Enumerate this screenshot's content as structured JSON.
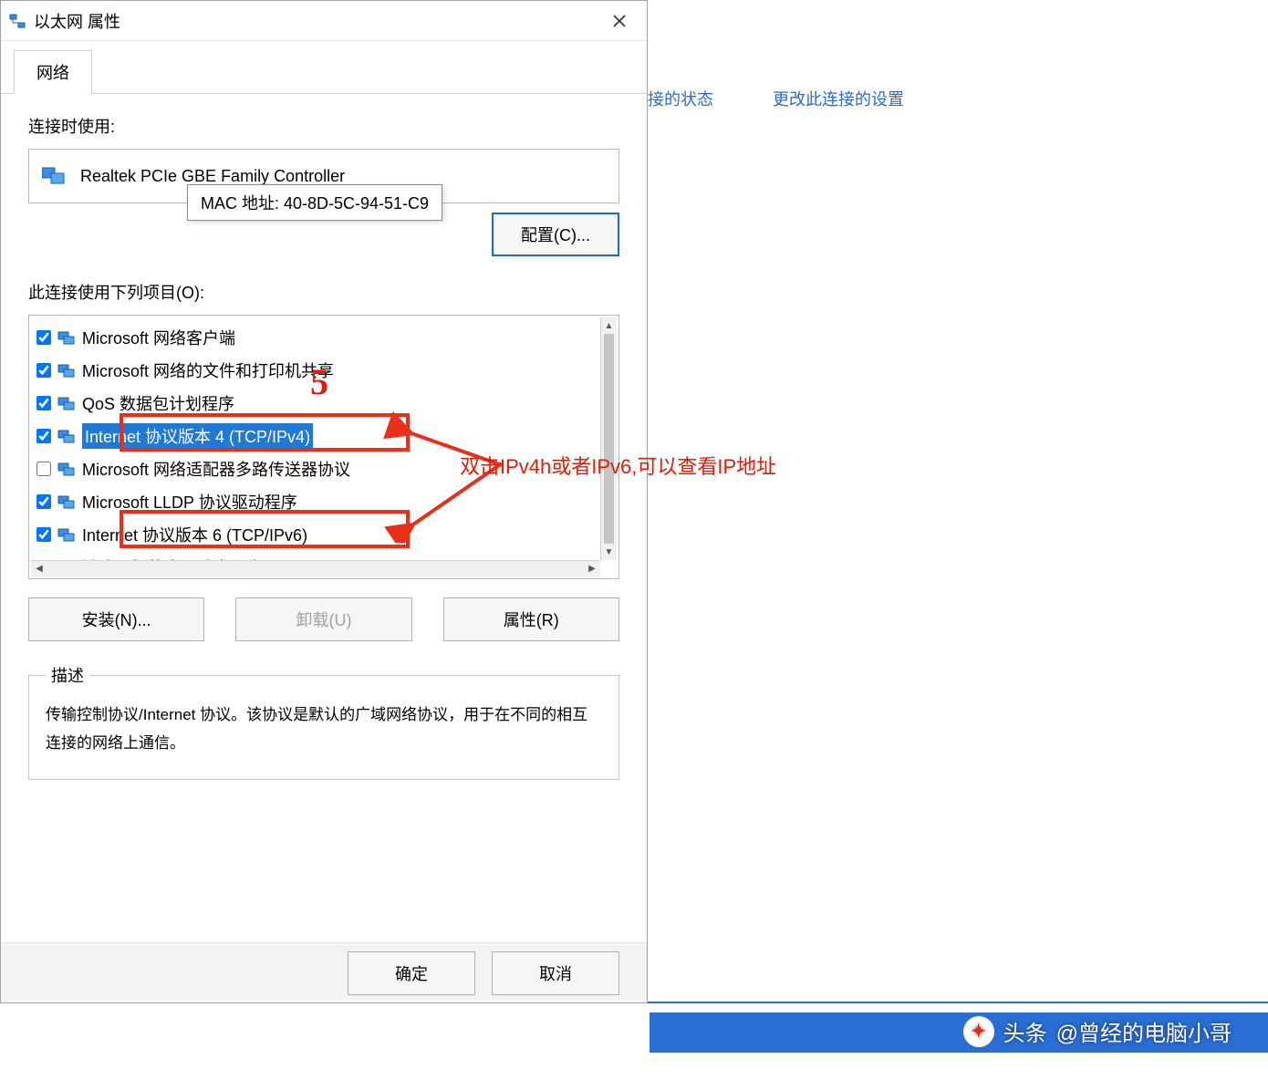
{
  "bg": {
    "link1": "接的状态",
    "link2": "更改此连接的设置"
  },
  "dialog": {
    "title": "以太网 属性",
    "tab": "网络",
    "connect_using": "连接时使用:",
    "device": "Realtek PCIe GBE Family Controller",
    "tooltip": "MAC 地址: 40-8D-5C-94-51-C9",
    "configure": "配置(C)...",
    "items_label": "此连接使用下列项目(O):",
    "items": [
      {
        "checked": true,
        "label": "Microsoft 网络客户端"
      },
      {
        "checked": true,
        "label": "Microsoft 网络的文件和打印机共享"
      },
      {
        "checked": true,
        "label": "QoS 数据包计划程序"
      },
      {
        "checked": true,
        "label": "Internet 协议版本 4 (TCP/IPv4)",
        "selected": true
      },
      {
        "checked": false,
        "label": "Microsoft 网络适配器多路传送器协议"
      },
      {
        "checked": true,
        "label": "Microsoft LLDP 协议驱动程序"
      },
      {
        "checked": true,
        "label": "Internet 协议版本 6 (TCP/IPv6)"
      },
      {
        "checked": true,
        "label": "链路层拓扑发现响应程序"
      }
    ],
    "install": "安装(N)...",
    "uninstall": "卸载(U)",
    "properties": "属性(R)",
    "desc_title": "描述",
    "desc_text": "传输控制协议/Internet 协议。该协议是默认的广域网络协议，用于在不同的相互连接的网络上通信。",
    "ok": "确定",
    "cancel": "取消"
  },
  "annotation": {
    "five": "5",
    "text": "双击IPv4h或者IPv6,可以查看IP地址"
  },
  "watermark": {
    "brand": "头条",
    "handle": "@曾经的电脑小哥"
  }
}
